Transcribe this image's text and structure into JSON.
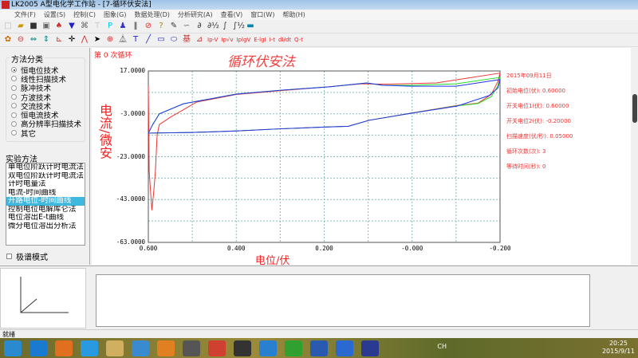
{
  "window": {
    "title": "LK2005 A型电化学工作站 - [7-循环伏安法]"
  },
  "menu": [
    "文件(F)",
    "设置(S)",
    "控制(C)",
    "图象(G)",
    "数据处理(D)",
    "分析研究(A)",
    "查看(V)",
    "窗口(W)",
    "帮助(H)"
  ],
  "toolbar1": [
    {
      "icon": "new-icon",
      "g": "□",
      "c": "#bbb"
    },
    {
      "icon": "open-icon",
      "g": "▰",
      "c": "#c90"
    },
    {
      "icon": "save-icon",
      "g": "■",
      "c": "#333"
    },
    {
      "icon": "print-icon",
      "g": "▣",
      "c": "#666"
    },
    {
      "icon": "electrode-icon",
      "g": "♠",
      "c": "#c33"
    },
    {
      "icon": "funnel-icon",
      "g": "▼",
      "c": "#22c"
    },
    {
      "icon": "cell-icon",
      "g": "⌘",
      "c": "#666"
    },
    {
      "icon": "t-icon",
      "g": "T",
      "c": "#ccc"
    },
    {
      "icon": "p-icon",
      "g": "P",
      "c": "#0ce"
    },
    {
      "icon": "run-icon",
      "g": "♟",
      "c": "#33c"
    },
    {
      "icon": "pause-icon",
      "g": "‖",
      "c": "#333"
    },
    {
      "icon": "stop-icon",
      "g": "⊘",
      "c": "#e22"
    },
    {
      "icon": "help-icon",
      "g": "?",
      "c": "#a80"
    },
    {
      "icon": "pen-icon",
      "g": "✎",
      "c": "#333"
    },
    {
      "icon": "smooth-icon",
      "g": "∽",
      "c": "#666"
    },
    {
      "icon": "derivative-icon",
      "g": "∂",
      "c": "#333"
    },
    {
      "icon": "half-derivative-icon",
      "g": "∂½",
      "c": "#333"
    },
    {
      "icon": "integral-icon",
      "g": "∫",
      "c": "#333"
    },
    {
      "icon": "half-integral-icon",
      "g": "∫½",
      "c": "#333"
    },
    {
      "icon": "monitor-icon",
      "g": "▬",
      "c": "#08a"
    }
  ],
  "toolbar2": [
    {
      "icon": "palette-icon",
      "g": "✿",
      "c": "#c60"
    },
    {
      "icon": "no-entry-icon",
      "g": "⊖",
      "c": "#c33"
    },
    {
      "icon": "horizontal-arrows-icon",
      "g": "⇔",
      "c": "#088"
    },
    {
      "icon": "vertical-arrows-icon",
      "g": "⇕",
      "c": "#088"
    },
    {
      "icon": "axis-icon",
      "g": "⊾",
      "c": "#c33"
    },
    {
      "icon": "crosshair-icon",
      "g": "✛",
      "c": "#000"
    },
    {
      "icon": "peak-icon",
      "g": "⋀",
      "c": "#c33"
    },
    {
      "icon": "pointer-icon",
      "g": "➤",
      "c": "#000"
    },
    {
      "icon": "target-icon",
      "g": "⊕",
      "c": "#e22"
    },
    {
      "icon": "peak-area-icon",
      "g": "⏅",
      "c": "#333"
    },
    {
      "icon": "text-icon",
      "g": "T",
      "c": "#22c"
    },
    {
      "icon": "line-icon",
      "g": "╱",
      "c": "#22c"
    },
    {
      "icon": "rectangle-icon",
      "g": "▭",
      "c": "#22c"
    },
    {
      "icon": "ellipse-icon",
      "g": "⬭",
      "c": "#22c"
    },
    {
      "icon": "baseline-icon",
      "g": "基",
      "c": "#c33"
    },
    {
      "icon": "zoom-axis-icon",
      "g": "⊿",
      "c": "#c33"
    },
    {
      "icon": "ip-v-icon",
      "g": "Ip-V",
      "c": "#e22"
    },
    {
      "icon": "ip-sqrtv-icon",
      "g": "Ip√v",
      "c": "#e22"
    },
    {
      "icon": "ip-lgv-icon",
      "g": "IplgV",
      "c": "#e22"
    },
    {
      "icon": "e-lgi-icon",
      "g": "E-lgI",
      "c": "#e22"
    },
    {
      "icon": "i-t-icon",
      "g": "I-t",
      "c": "#e22"
    },
    {
      "icon": "di-dt-icon",
      "g": "dI/dt",
      "c": "#e22"
    },
    {
      "icon": "q-t-icon",
      "g": "Q-t",
      "c": "#e22"
    }
  ],
  "left": {
    "group_title": "方法分类",
    "methods": [
      {
        "label": "恒电位技术",
        "selected": true
      },
      {
        "label": "线性扫描技术",
        "selected": false
      },
      {
        "label": "脉冲技术",
        "selected": false
      },
      {
        "label": "方波技术",
        "selected": false
      },
      {
        "label": "交流技术",
        "selected": false
      },
      {
        "label": "恒电流技术",
        "selected": false
      },
      {
        "label": "高分辨率扫描技术",
        "selected": false
      },
      {
        "label": "其它",
        "selected": false
      }
    ],
    "exp_label": "实验方法",
    "experiments": [
      "单电位阶跃计时电流法",
      "双电位阶跃计时电流法",
      "计时电量法",
      "电流-时间曲线",
      "开路电位-时间曲线",
      "控制电位电解库仑法",
      "电位溶出E-t曲线",
      "微分电位溶出分析法"
    ],
    "selected_experiment": 4,
    "polar_label": "极谱模式",
    "polar_checked": false
  },
  "chart_header": {
    "cycle": "第 0 次循环"
  },
  "info": [
    "2015年09月11日",
    "初始电位(伏): 0.60000",
    "开关电位1(伏): 0.60000",
    "开关电位2(伏): -0.20000",
    "扫描速度(伏/秒): 0.05000",
    "循环次数(次): 3",
    "等待时间(秒): 0"
  ],
  "chart_data": {
    "type": "line",
    "title": "循环伏安法",
    "xlabel": "电位/伏",
    "ylabel": "电流/微安",
    "xlim": [
      0.6,
      -0.2
    ],
    "ylim": [
      -63,
      17
    ],
    "xticks": [
      "0.600",
      "0.400",
      "0.200",
      "-0.000",
      "-0.200"
    ],
    "yticks": [
      "17.0000",
      "-3.0000",
      "-23.0000",
      "-43.0000",
      "-63.0000"
    ],
    "grid": true,
    "series": [
      {
        "color": "#ee3333",
        "points": [
          [
            0.6,
            10
          ],
          [
            0.598,
            -30
          ],
          [
            0.592,
            -48
          ],
          [
            0.588,
            -40
          ],
          [
            0.584,
            -30
          ],
          [
            0.58,
            -13
          ],
          [
            0.575,
            -8
          ],
          [
            0.55,
            -4.6
          ],
          [
            0.49,
            2.5
          ],
          [
            0.4,
            6
          ],
          [
            0.3,
            7.8
          ],
          [
            0.19,
            9.6
          ],
          [
            0.116,
            11
          ],
          [
            0.06,
            10.8
          ],
          [
            -0.055,
            11.4
          ],
          [
            -0.2,
            16
          ],
          [
            -0.195,
            12
          ],
          [
            -0.18,
            6
          ],
          [
            -0.15,
            2
          ],
          [
            -0.1,
            0.8
          ],
          [
            0,
            -2.6
          ],
          [
            0.0975,
            -6
          ],
          [
            0.145,
            -8.8
          ],
          [
            0.2,
            -9.2
          ],
          [
            0.3,
            -10
          ],
          [
            0.4,
            -11
          ],
          [
            0.5,
            -11.7
          ],
          [
            0.6,
            -12
          ]
        ]
      },
      {
        "color": "#22dd22",
        "points": [
          [
            0.6,
            -12
          ],
          [
            0.59,
            -8
          ],
          [
            0.575,
            -3
          ],
          [
            0.52,
            1.7
          ],
          [
            0.4,
            6.2
          ],
          [
            0.3,
            8
          ],
          [
            0.188,
            9.6
          ],
          [
            0.103,
            11.4
          ],
          [
            0.067,
            10.3
          ],
          [
            0,
            10.3
          ],
          [
            -0.1,
            11
          ],
          [
            -0.2,
            14
          ],
          [
            -0.195,
            10
          ],
          [
            -0.18,
            5
          ],
          [
            -0.15,
            1.8
          ],
          [
            -0.102,
            0.7
          ],
          [
            -0.002,
            -2.6
          ],
          [
            0.0975,
            -6
          ],
          [
            0.145,
            -8.8
          ],
          [
            0.2,
            -9.2
          ],
          [
            0.3,
            -10
          ],
          [
            0.4,
            -11
          ],
          [
            0.5,
            -11.7
          ],
          [
            0.6,
            -12
          ]
        ]
      },
      {
        "color": "#2233ee",
        "points": [
          [
            0.6,
            -12
          ],
          [
            0.59,
            -8
          ],
          [
            0.575,
            -3
          ],
          [
            0.52,
            1.7
          ],
          [
            0.4,
            6.2
          ],
          [
            0.3,
            8
          ],
          [
            0.188,
            9.6
          ],
          [
            0.103,
            11.4
          ],
          [
            0.067,
            10.3
          ],
          [
            0,
            9.9
          ],
          [
            -0.1,
            9.9
          ],
          [
            -0.2,
            13
          ],
          [
            -0.195,
            9
          ],
          [
            -0.175,
            5.5
          ],
          [
            -0.102,
            0.6
          ],
          [
            -0.002,
            -2.6
          ],
          [
            0.0975,
            -6
          ],
          [
            0.145,
            -8.8
          ],
          [
            0.2,
            -9.2
          ],
          [
            0.3,
            -10
          ],
          [
            0.4,
            -11
          ],
          [
            0.5,
            -11.7
          ],
          [
            0.6,
            -12
          ]
        ]
      }
    ]
  },
  "status": "就绪",
  "taskbar": {
    "apps": [
      {
        "icon": "start-icon",
        "c": "#2a8ad0"
      },
      {
        "icon": "ie-icon",
        "c": "#1a7ad0"
      },
      {
        "icon": "media-player-icon",
        "c": "#e07020"
      },
      {
        "icon": "cloud-icon",
        "c": "#2a9ae0"
      },
      {
        "icon": "explorer-icon",
        "c": "#d0b060"
      },
      {
        "icon": "bird-icon",
        "c": "#3a8ad0"
      },
      {
        "icon": "package-icon",
        "c": "#e08020"
      },
      {
        "icon": "film-icon",
        "c": "#555"
      },
      {
        "icon": "chrome-icon",
        "c": "#d04030"
      },
      {
        "icon": "qq-icon",
        "c": "#333"
      },
      {
        "icon": "globe-icon",
        "c": "#2a80d0"
      },
      {
        "icon": "shield-plus-icon",
        "c": "#30a030"
      },
      {
        "icon": "word-icon",
        "c": "#2a5ab0"
      },
      {
        "icon": "help-circle-icon",
        "c": "#2a6ad0"
      },
      {
        "icon": "lk-icon",
        "c": "#2a3a90"
      }
    ],
    "tray_lang": "CH",
    "time": "20:25",
    "date": "2015/9/11"
  }
}
